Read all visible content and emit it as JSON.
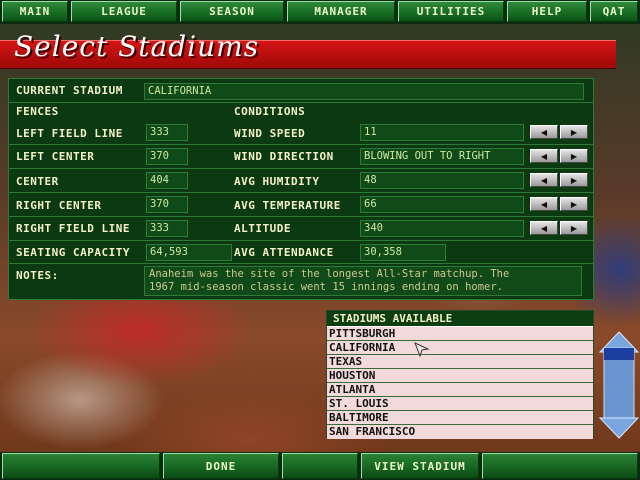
{
  "menu": [
    "MAIN",
    "LEAGUE",
    "SEASON",
    "MANAGER",
    "UTILITIES",
    "HELP",
    "QAT"
  ],
  "title": "Select Stadiums",
  "current_stadium": {
    "label": "CURRENT STADIUM",
    "value": "CALIFORNIA"
  },
  "fences": {
    "heading": "FENCES",
    "rows": [
      {
        "label": "LEFT FIELD LINE",
        "value": "333"
      },
      {
        "label": "LEFT CENTER",
        "value": "370"
      },
      {
        "label": "CENTER",
        "value": "404"
      },
      {
        "label": "RIGHT CENTER",
        "value": "370"
      },
      {
        "label": "RIGHT FIELD LINE",
        "value": "333"
      }
    ]
  },
  "conditions": {
    "heading": "CONDITIONS",
    "rows": [
      {
        "label": "WIND SPEED",
        "value": "11"
      },
      {
        "label": "WIND DIRECTION",
        "value": "BLOWING OUT TO RIGHT"
      },
      {
        "label": "AVG HUMIDITY",
        "value": "48"
      },
      {
        "label": "AVG TEMPERATURE",
        "value": "66"
      },
      {
        "label": "ALTITUDE",
        "value": "340"
      }
    ]
  },
  "seating": {
    "label": "SEATING CAPACITY",
    "value": "64,593"
  },
  "attendance": {
    "label": "AVG ATTENDANCE",
    "value": "30,358"
  },
  "notes": {
    "label": "NOTES:",
    "line1": "Anaheim was the site of the longest All-Star matchup. The",
    "line2": "1967 mid-season classic went 15 innings ending on homer."
  },
  "stadiums": {
    "heading": "STADIUMS AVAILABLE",
    "items": [
      "PITTSBURGH",
      "CALIFORNIA",
      "TEXAS",
      "HOUSTON",
      "ATLANTA",
      "ST. LOUIS",
      "BALTIMORE",
      "SAN FRANCISCO"
    ]
  },
  "bottom": {
    "done": "DONE",
    "view": "VIEW STADIUM"
  },
  "icons": [
    "arrow-left-icon",
    "arrow-right-icon",
    "scroll-up-icon",
    "scroll-down-icon",
    "pointer-cursor-icon"
  ],
  "colors": {
    "title_band": "#c81010",
    "panel": "#0b3a12",
    "button": "#1e7a2a",
    "list_row": "#f2dada"
  }
}
